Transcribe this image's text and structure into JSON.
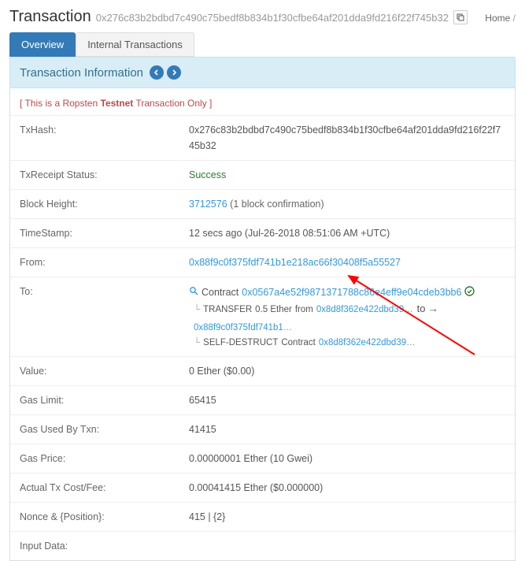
{
  "header": {
    "title": "Transaction",
    "txhash": "0x276c83b2bdbd7c490c75bedf8b834b1f30cfbe64af201dda9fd216f22f745b32",
    "home": "Home",
    "sep": "/"
  },
  "tabs": {
    "overview": "Overview",
    "internal": "Internal Transactions"
  },
  "panel": {
    "heading": "Transaction Information"
  },
  "testnet": {
    "open": "[ This is a Ropsten",
    "bold": "Testnet",
    "close": "Transaction Only ]"
  },
  "fields": {
    "txhash_label": "TxHash:",
    "txhash_value": "0x276c83b2bdbd7c490c75bedf8b834b1f30cfbe64af201dda9fd216f22f745b32",
    "receipt_label": "TxReceipt Status:",
    "receipt_value": "Success",
    "block_label": "Block Height:",
    "block_value": "3712576",
    "block_conf": "(1 block confirmation)",
    "ts_label": "TimeStamp:",
    "ts_value": "12 secs ago (Jul-26-2018 08:51:06 AM +UTC)",
    "from_label": "From:",
    "from_value": "0x88f9c0f375fdf741b1e218ac66f30408f5a55527",
    "to_label": "To:",
    "to_contract_word": "Contract",
    "to_contract_addr": "0x0567a4e52f9871371788c86e4eff9e04cdeb3bb6",
    "transfer_label": "TRANSFER",
    "transfer_amount": "0.5 Ether",
    "transfer_from_word": "from",
    "transfer_from_addr": "0x8d8f362e422dbd39",
    "transfer_to_word": "to →",
    "transfer_to_addr": "0x88f9c0f375fdf741b1",
    "selfdestruct_label": "SELF-DESTRUCT",
    "selfdestruct_word": "Contract",
    "selfdestruct_addr": "0x8d8f362e422dbd39",
    "value_label": "Value:",
    "value_value": "0 Ether ($0.00)",
    "gaslimit_label": "Gas Limit:",
    "gaslimit_value": "65415",
    "gasused_label": "Gas Used By Txn:",
    "gasused_value": "41415",
    "gasprice_label": "Gas Price:",
    "gasprice_value": "0.00000001 Ether (10 Gwei)",
    "cost_label": "Actual Tx Cost/Fee:",
    "cost_value": "0.00041415 Ether ($0.000000)",
    "nonce_label": "Nonce & {Position}:",
    "nonce_value": "415 | {2}",
    "input_label": "Input Data:"
  }
}
